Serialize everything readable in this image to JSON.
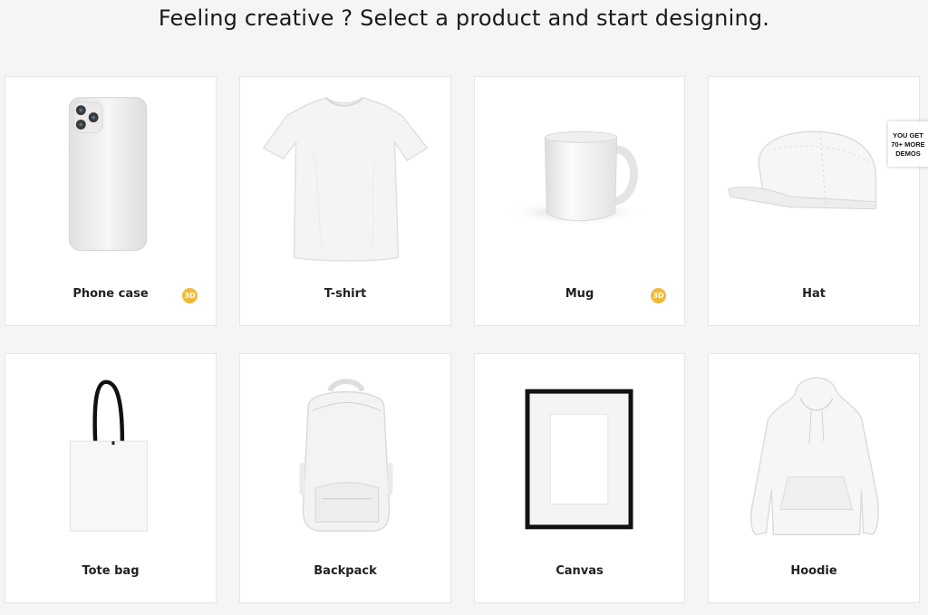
{
  "header": {
    "title": "Feeling creative ? Select a product and start designing."
  },
  "products": [
    {
      "label": "Phone case",
      "icon": "phone-case-icon",
      "badge": "3D"
    },
    {
      "label": "T-shirt",
      "icon": "tshirt-icon"
    },
    {
      "label": "Mug",
      "icon": "mug-icon",
      "badge": "3D"
    },
    {
      "label": "Hat",
      "icon": "hat-icon"
    },
    {
      "label": "Tote bag",
      "icon": "tote-bag-icon"
    },
    {
      "label": "Backpack",
      "icon": "backpack-icon"
    },
    {
      "label": "Canvas",
      "icon": "canvas-frame-icon"
    },
    {
      "label": "Hoodie",
      "icon": "hoodie-icon"
    }
  ],
  "promo": {
    "line1": "YOU GET",
    "line2": "70+ MORE",
    "line3": "DEMOS"
  },
  "colors": {
    "background": "#f5f5f5",
    "badge": "#f0b93a",
    "card": "#ffffff"
  }
}
